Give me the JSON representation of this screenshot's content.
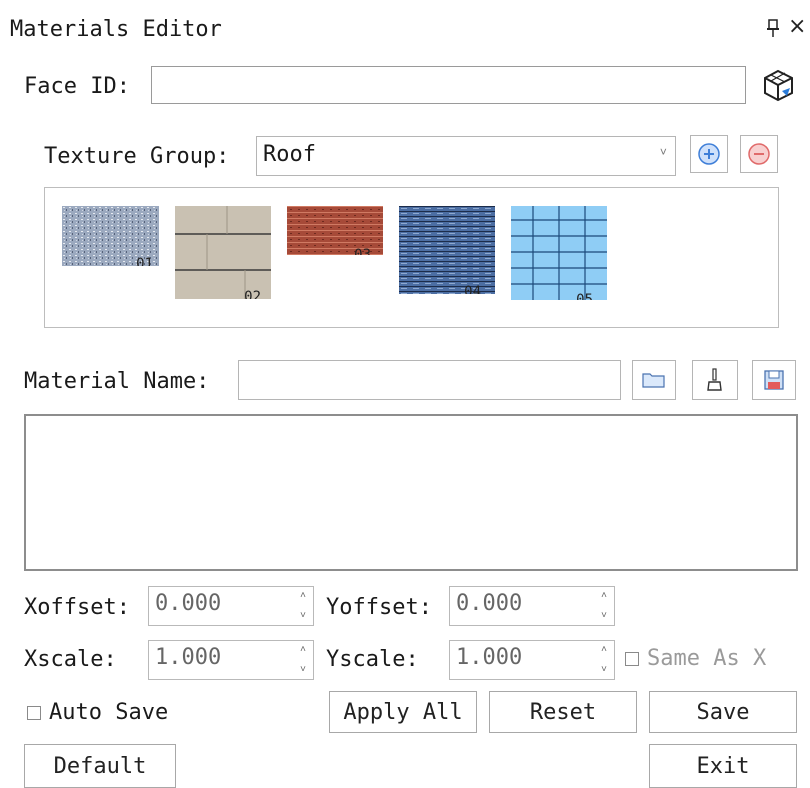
{
  "window": {
    "title": "Materials Editor",
    "pin": "ᵖ",
    "close": "×"
  },
  "face": {
    "label": "Face ID:",
    "value": ""
  },
  "texture_group": {
    "label": "Texture Group:",
    "selected": "Roof",
    "thumbnails": [
      {
        "number": "01",
        "style": "noise-gray"
      },
      {
        "number": "02",
        "style": "beige-planks"
      },
      {
        "number": "03",
        "style": "red-brick"
      },
      {
        "number": "04",
        "style": "blue-slate"
      },
      {
        "number": "05",
        "style": "blue-grid"
      }
    ]
  },
  "material": {
    "label": "Material Name:",
    "value": ""
  },
  "offset": {
    "x_label": "Xoffset:",
    "x_value": "0.000",
    "y_label": "Yoffset:",
    "y_value": "0.000"
  },
  "scale": {
    "x_label": "Xscale:",
    "x_value": "1.000",
    "y_label": "Yscale:",
    "y_value": "1.000",
    "same_as_x": "Same As X"
  },
  "actions": {
    "auto_save": "Auto Save",
    "apply_all": "Apply All",
    "reset": "Reset",
    "save": "Save",
    "default": "Default",
    "exit": "Exit"
  },
  "colors": {
    "add_accent": "#3f7fd8",
    "remove_accent": "#e06a6a",
    "grid_blue": "#7cc0ef"
  }
}
